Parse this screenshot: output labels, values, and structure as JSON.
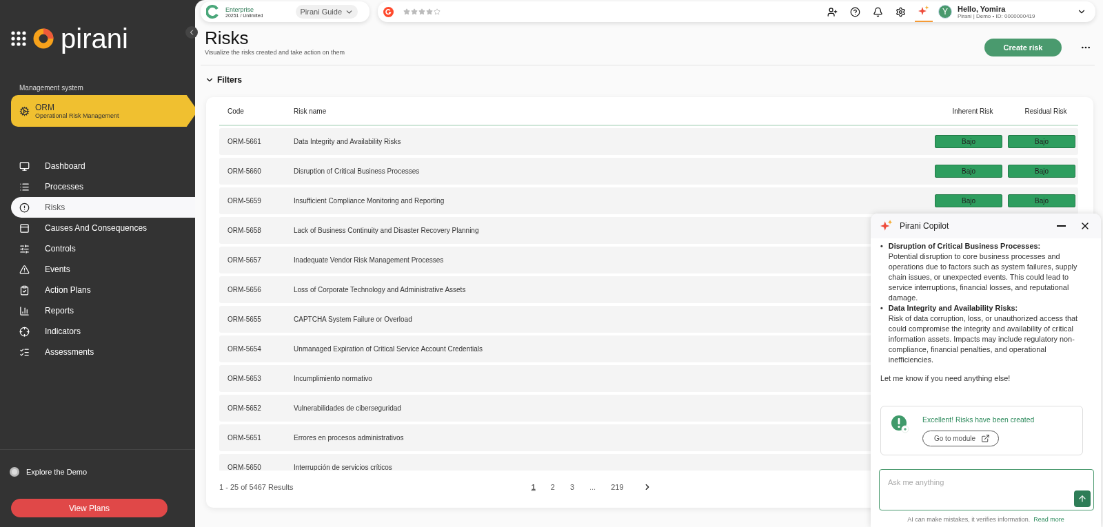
{
  "sidebar": {
    "logo_text": "pirani",
    "section_label": "Management system",
    "module": {
      "title": "ORM",
      "subtitle": "Operational Risk Management"
    },
    "items": [
      {
        "label": "Dashboard",
        "selected": false
      },
      {
        "label": "Processes",
        "selected": false
      },
      {
        "label": "Risks",
        "selected": true
      },
      {
        "label": "Causes And Consequences",
        "selected": false
      },
      {
        "label": "Controls",
        "selected": false
      },
      {
        "label": "Events",
        "selected": false
      },
      {
        "label": "Action Plans",
        "selected": false
      },
      {
        "label": "Reports",
        "selected": false
      },
      {
        "label": "Indicators",
        "selected": false
      },
      {
        "label": "Assessments",
        "selected": false
      }
    ],
    "explore": "Explore the Demo",
    "plans_button": "View Plans"
  },
  "topbar": {
    "plan": {
      "name": "Enterprise",
      "detail": "20251 / Unlimited"
    },
    "guide": "Pirani Guide",
    "rating": {
      "stars": 4
    },
    "user": {
      "initial": "Y",
      "greeting": "Hello, Yomira",
      "detail": "Pirani | Demo • ID: 0000000419"
    }
  },
  "page": {
    "title": "Risks",
    "subtitle": "Visualize the risks created and take action on them",
    "primary_button": "Create risk",
    "filters": {
      "label": "Filters",
      "expanded": true
    }
  },
  "table": {
    "columns": [
      "Code",
      "Risk name",
      "Inherent Risk",
      "Residual Risk"
    ],
    "rows": [
      {
        "code": "ORM-5661",
        "name": "Data Integrity and Availability Risks",
        "inherent": "Bajo",
        "residual": "Bajo"
      },
      {
        "code": "ORM-5660",
        "name": "Disruption of Critical Business Processes",
        "inherent": "Bajo",
        "residual": "Bajo"
      },
      {
        "code": "ORM-5659",
        "name": "Insufficient Compliance Monitoring and Reporting",
        "inherent": "Bajo",
        "residual": "Bajo"
      },
      {
        "code": "ORM-5658",
        "name": "Lack of Business Continuity and Disaster Recovery Planning"
      },
      {
        "code": "ORM-5657",
        "name": "Inadequate Vendor Risk Management Processes"
      },
      {
        "code": "ORM-5656",
        "name": "Loss of Corporate Technology and Administrative Assets"
      },
      {
        "code": "ORM-5655",
        "name": "CAPTCHA System Failure or Overload"
      },
      {
        "code": "ORM-5654",
        "name": "Unmanaged Expiration of Critical Service Account Credentials"
      },
      {
        "code": "ORM-5653",
        "name": "Incumplimiento normativo"
      },
      {
        "code": "ORM-5652",
        "name": "Vulnerabilidades de ciberseguridad"
      },
      {
        "code": "ORM-5651",
        "name": "Errores en procesos administrativos"
      },
      {
        "code": "ORM-5650",
        "name": "Interrupción de servicios críticos"
      }
    ]
  },
  "pagination": {
    "summary": "1 - 25 of 5467 Results",
    "pages": [
      {
        "kind": "page",
        "label": "1",
        "selected": true
      },
      {
        "kind": "page",
        "label": "2",
        "selected": false
      },
      {
        "kind": "page",
        "label": "3",
        "selected": false
      },
      {
        "kind": "gap",
        "label": "..."
      },
      {
        "kind": "page",
        "label": "219",
        "selected": false
      }
    ]
  },
  "copilot": {
    "title": "Pirani Copilot",
    "messages": [
      {
        "bullet": "•",
        "title": "Disruption of Critical Business Processes:",
        "text": "Potential disruption to core business processes and operations due to factors such as system failures, supply chain issues, or unexpected events. This could lead to service interruptions, financial losses, and reputational damage."
      },
      {
        "bullet": "•",
        "title": "Data Integrity and Availability Risks:",
        "text": "Risk of data corruption, loss, or unauthorized access that could compromise the integrity and availability of critical information assets. Impacts may include regulatory non-compliance, financial penalties, and operational inefficiencies."
      }
    ],
    "closing": "Let me know if you need anything else!",
    "notice": {
      "text": "Excellent! Risks have been created",
      "button": "Go to module"
    },
    "input": {
      "placeholder": "Ask me anything"
    },
    "disclaimer": "AI can make mistakes, it verifies information.",
    "disclaimer_link": "Read more"
  }
}
